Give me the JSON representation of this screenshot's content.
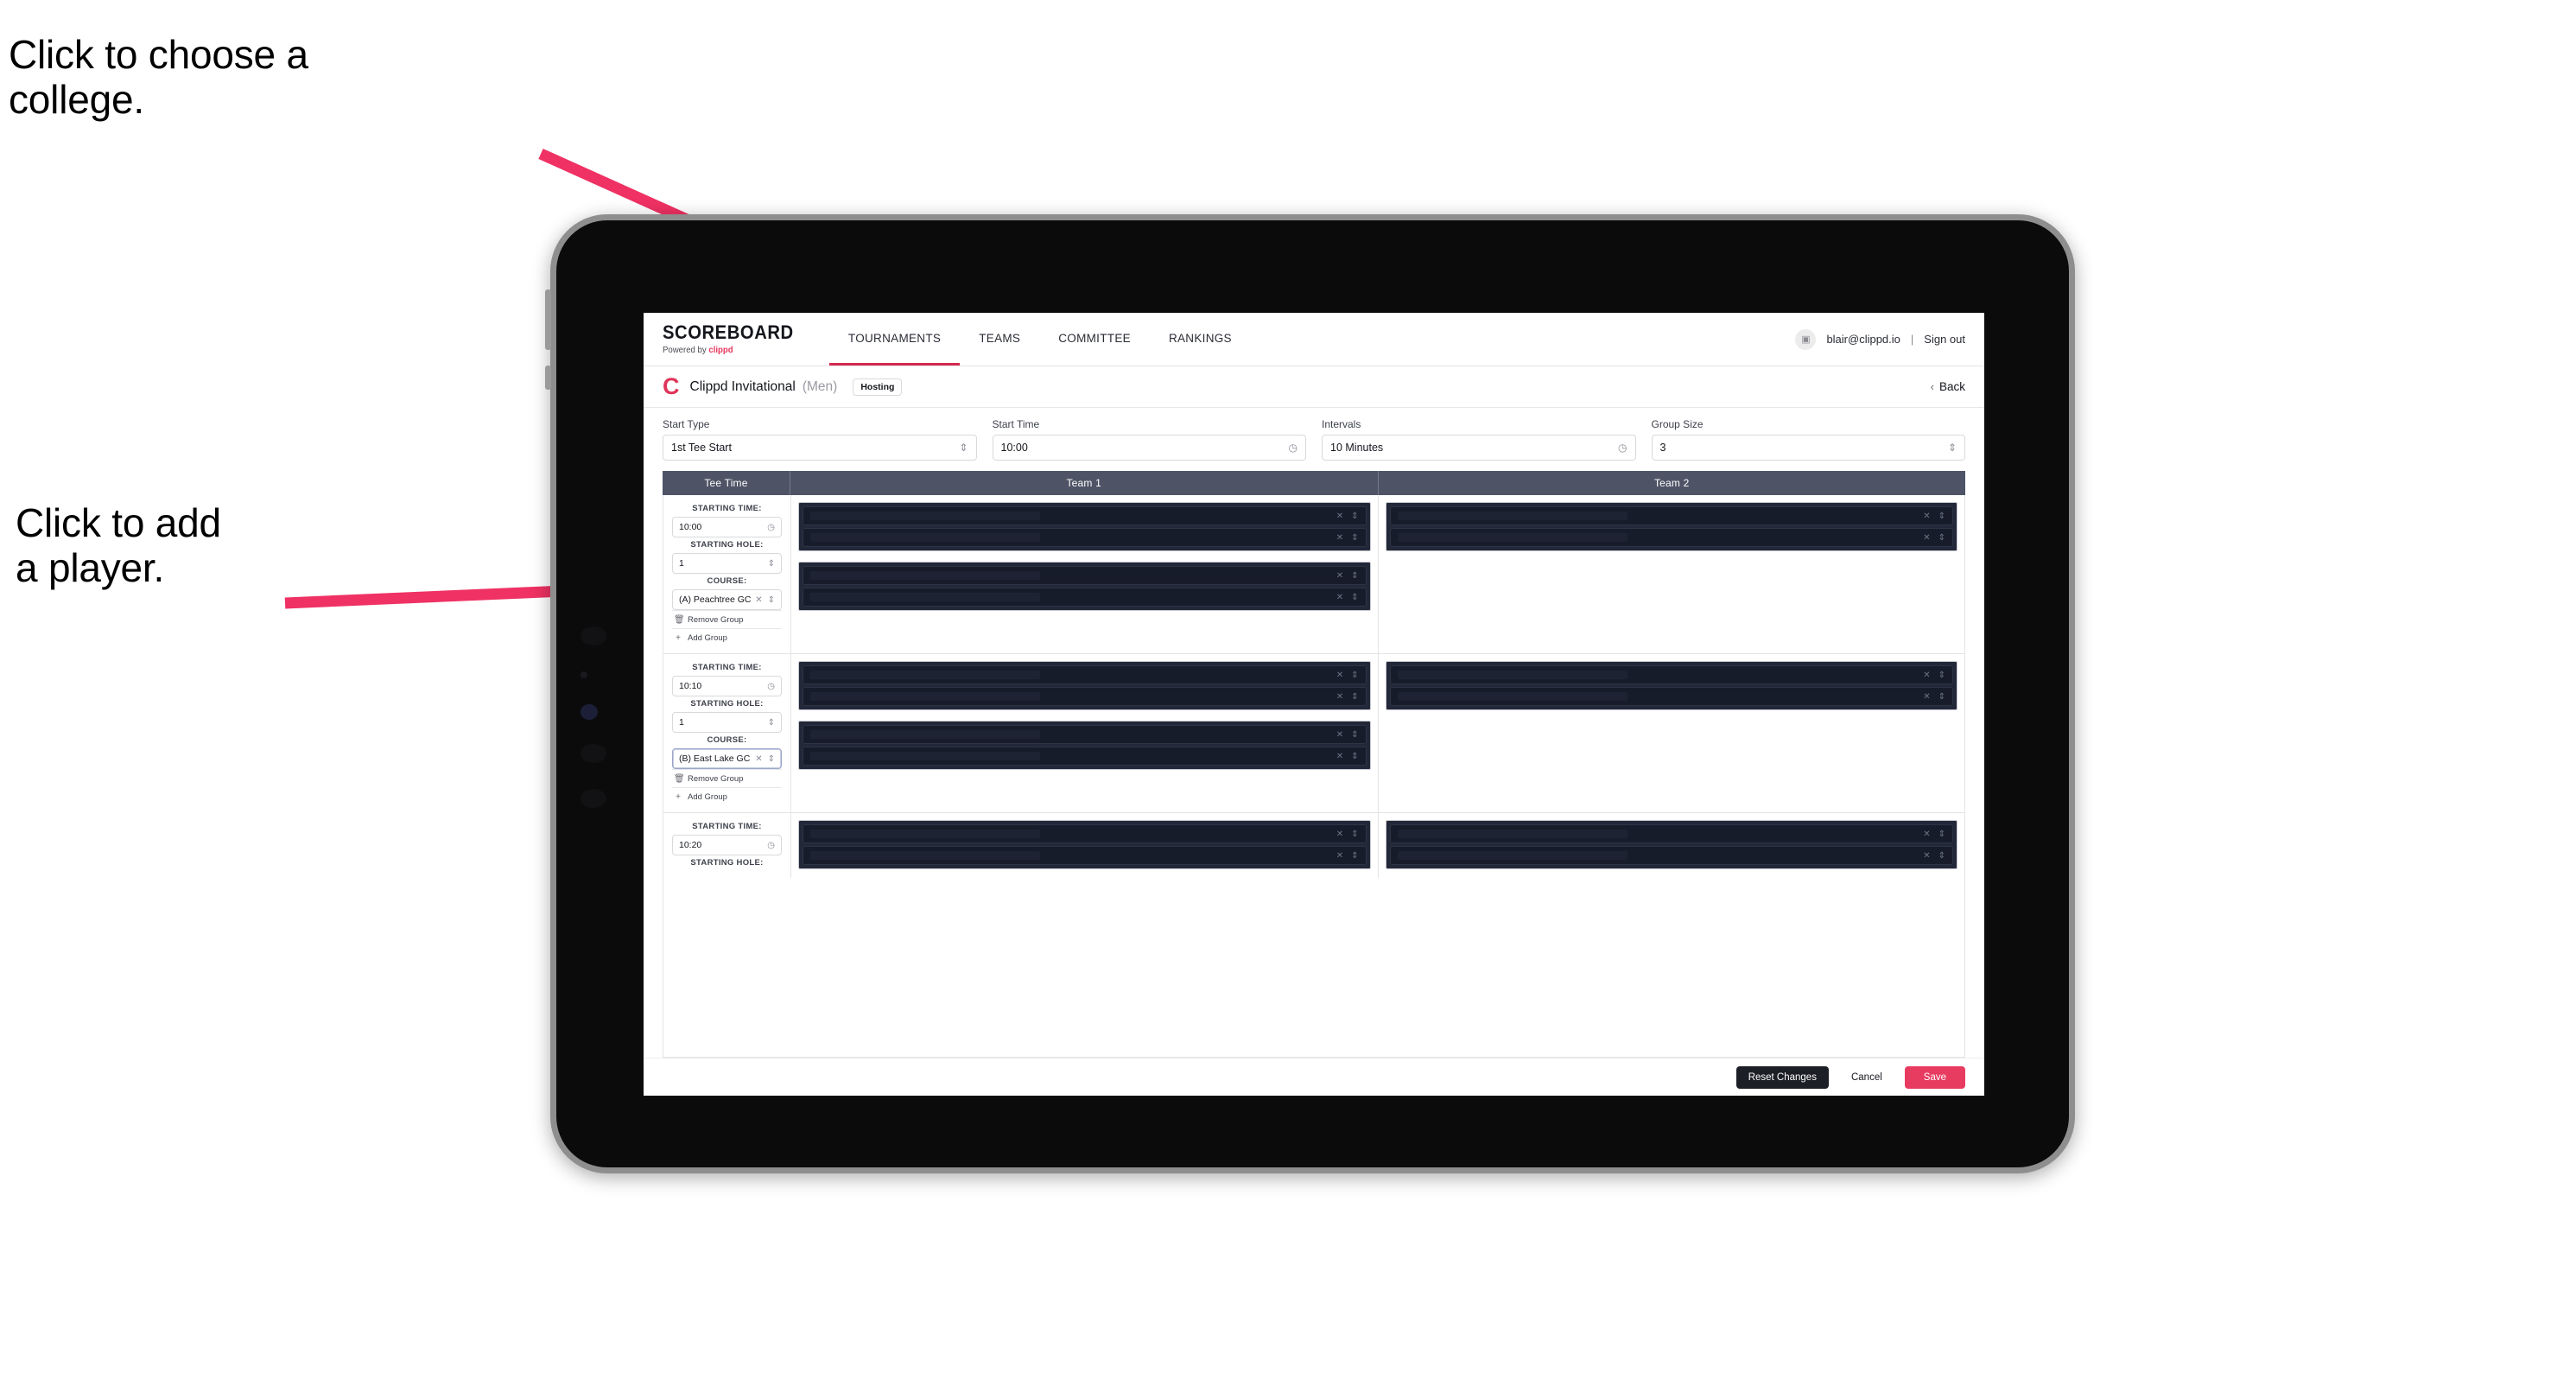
{
  "annotations": {
    "college": "Click to choose a\ncollege.",
    "player": "Click to add\na player."
  },
  "colors": {
    "accent_pink": "#e83b60",
    "arrow_pink": "#ef3163",
    "header_slate": "#4e5466",
    "player_dark": "#222838"
  },
  "topnav": {
    "brand_title": "SCOREBOARD",
    "brand_sub_prefix": "Powered by ",
    "brand_sub_brand": "clippd",
    "tabs": [
      {
        "label": "TOURNAMENTS",
        "active": true
      },
      {
        "label": "TEAMS",
        "active": false
      },
      {
        "label": "COMMITTEE",
        "active": false
      },
      {
        "label": "RANKINGS",
        "active": false
      }
    ],
    "avatar_glyph": "▣",
    "email": "blair@clippd.io",
    "separator": "|",
    "sign_out": "Sign out"
  },
  "titlebar": {
    "logo_letter": "C",
    "tournament_name": "Clippd Invitational",
    "gender": "(Men)",
    "hosting_chip": "Hosting",
    "back_chevron": "‹",
    "back_label": "Back"
  },
  "controls": [
    {
      "label": "Start Type",
      "value": "1st Tee Start",
      "icon": "⇕",
      "icon_name": "stepper-icon"
    },
    {
      "label": "Start Time",
      "value": "10:00",
      "icon": "◷",
      "icon_name": "clock-icon"
    },
    {
      "label": "Intervals",
      "value": "10 Minutes",
      "icon": "◷",
      "icon_name": "clock-icon"
    },
    {
      "label": "Group Size",
      "value": "3",
      "icon": "⇕",
      "icon_name": "stepper-icon"
    }
  ],
  "table": {
    "headers": [
      "Tee Time",
      "Team 1",
      "Team 2"
    ],
    "field_labels": {
      "starting_time": "STARTING TIME:",
      "starting_hole": "STARTING HOLE:",
      "course": "COURSE:"
    },
    "actions": {
      "remove_group": "Remove Group",
      "remove_icon": "🗑",
      "add_group": "Add Group",
      "add_icon": "+"
    },
    "row_icons": {
      "clear": "✕",
      "stepper": "⇕"
    },
    "groups": [
      {
        "starting_time": "10:00",
        "starting_hole": "1",
        "course": "(A) Peachtree GC",
        "course_focused": false,
        "team1_blocks": 2,
        "team2_blocks": 1
      },
      {
        "starting_time": "10:10",
        "starting_hole": "1",
        "course": "(B) East Lake GC",
        "course_focused": true,
        "team1_blocks": 2,
        "team2_blocks": 1
      },
      {
        "starting_time": "10:20",
        "starting_hole": "",
        "course": "",
        "course_focused": false,
        "team1_blocks": 1,
        "team2_blocks": 1
      }
    ]
  },
  "footer": {
    "reset": "Reset Changes",
    "cancel": "Cancel",
    "save": "Save"
  }
}
